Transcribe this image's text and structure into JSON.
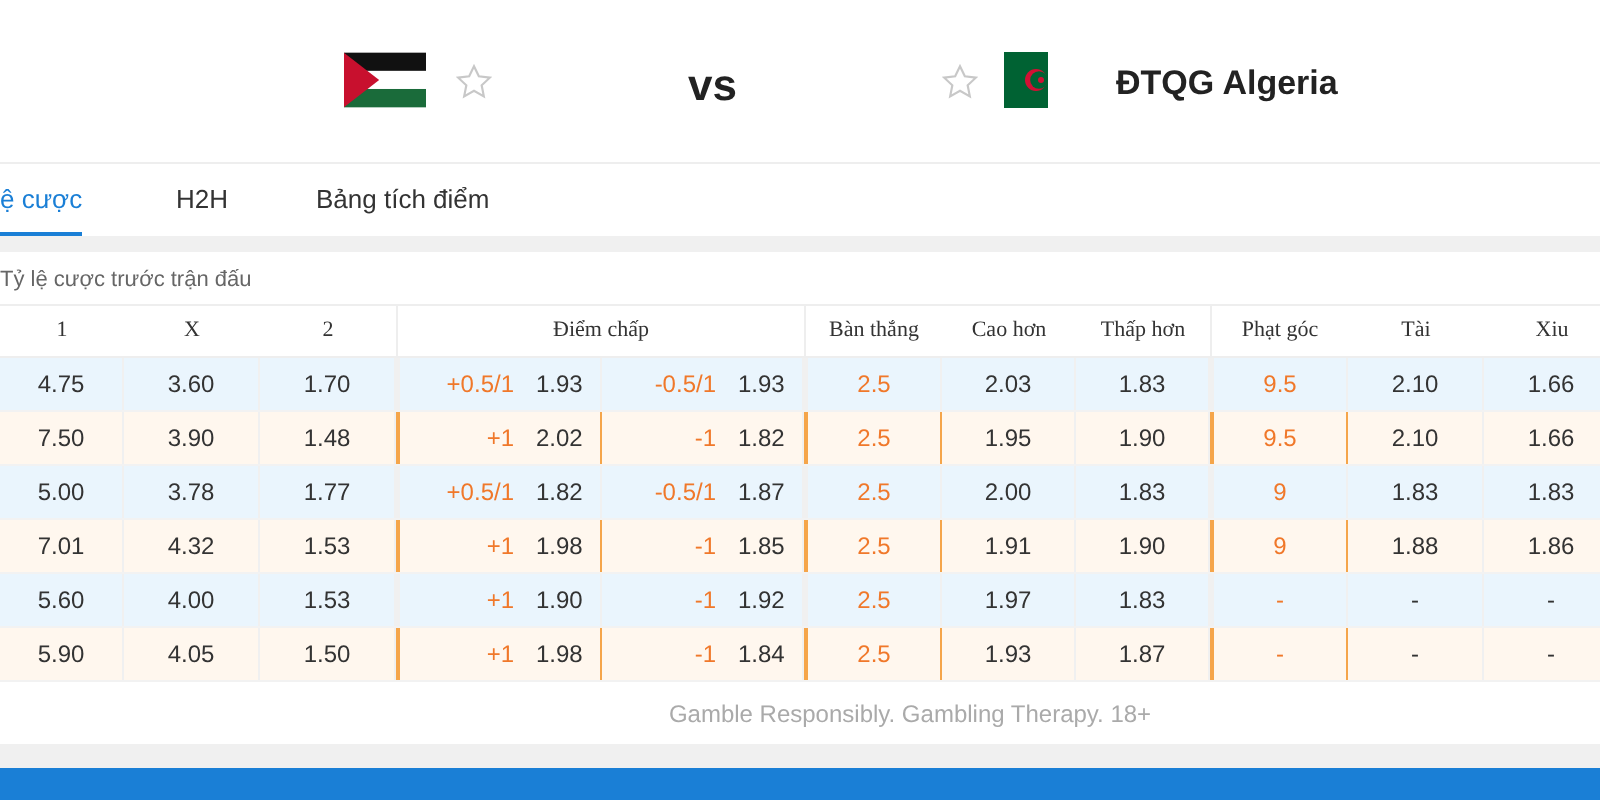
{
  "match": {
    "home_favorite": false,
    "vs": "vs",
    "away_favorite": false,
    "away_name": "ĐTQG Algeria"
  },
  "tabs": [
    {
      "label": "ệ cược",
      "selected": true
    },
    {
      "label": "H2H",
      "selected": false
    },
    {
      "label": "Bảng tích điểm",
      "selected": false
    }
  ],
  "section_title": "Tỷ lệ cược trước trận đấu",
  "table": {
    "columns": {
      "result": [
        "1",
        "X",
        "2"
      ],
      "handicap": "Điểm chấp",
      "goals": [
        "Bàn thắng",
        "Cao hơn",
        "Thấp hơn"
      ],
      "corners": [
        "Phạt góc",
        "Tài",
        "Xiu"
      ]
    },
    "rows": [
      {
        "kind": "early",
        "result": [
          "4.75",
          "3.60",
          "1.70"
        ],
        "handicap": [
          {
            "line": "+0.5/1",
            "odds": "1.93"
          },
          {
            "line": "-0.5/1",
            "odds": "1.93"
          }
        ],
        "goals": [
          "2.5",
          "2.03",
          "1.83"
        ],
        "corners": [
          "9.5",
          "2.10",
          "1.66"
        ]
      },
      {
        "kind": "live",
        "result": [
          "7.50",
          "3.90",
          "1.48"
        ],
        "handicap": [
          {
            "line": "+1",
            "odds": "2.02"
          },
          {
            "line": "-1",
            "odds": "1.82"
          }
        ],
        "goals": [
          "2.5",
          "1.95",
          "1.90"
        ],
        "corners": [
          "9.5",
          "2.10",
          "1.66"
        ]
      },
      {
        "kind": "early",
        "result": [
          "5.00",
          "3.78",
          "1.77"
        ],
        "handicap": [
          {
            "line": "+0.5/1",
            "odds": "1.82"
          },
          {
            "line": "-0.5/1",
            "odds": "1.87"
          }
        ],
        "goals": [
          "2.5",
          "2.00",
          "1.83"
        ],
        "corners": [
          "9",
          "1.83",
          "1.83"
        ]
      },
      {
        "kind": "live",
        "result": [
          "7.01",
          "4.32",
          "1.53"
        ],
        "handicap": [
          {
            "line": "+1",
            "odds": "1.98"
          },
          {
            "line": "-1",
            "odds": "1.85"
          }
        ],
        "goals": [
          "2.5",
          "1.91",
          "1.90"
        ],
        "corners": [
          "9",
          "1.88",
          "1.86"
        ]
      },
      {
        "kind": "early",
        "result": [
          "5.60",
          "4.00",
          "1.53"
        ],
        "handicap": [
          {
            "line": "+1",
            "odds": "1.90"
          },
          {
            "line": "-1",
            "odds": "1.92"
          }
        ],
        "goals": [
          "2.5",
          "1.97",
          "1.83"
        ],
        "corners": [
          "-",
          "-",
          "-"
        ]
      },
      {
        "kind": "live",
        "result": [
          "5.90",
          "4.05",
          "1.50"
        ],
        "handicap": [
          {
            "line": "+1",
            "odds": "1.98"
          },
          {
            "line": "-1",
            "odds": "1.84"
          }
        ],
        "goals": [
          "2.5",
          "1.93",
          "1.87"
        ],
        "corners": [
          "-",
          "-",
          "-"
        ]
      }
    ]
  },
  "footer_note": "Gamble Responsibly. Gambling Therapy. 18+"
}
